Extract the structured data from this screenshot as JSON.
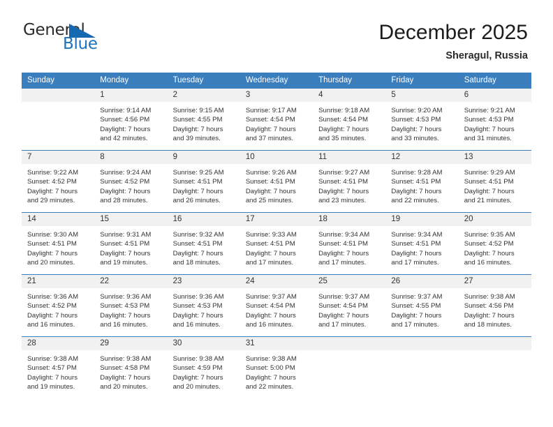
{
  "brand": {
    "name_part1": "General",
    "name_part2": "Blue",
    "triangle_icon": "triangle-icon",
    "colors": {
      "dark": "#2b2b2b",
      "blue": "#1e72bb",
      "header_blue": "#3b7ebe",
      "band_gray": "#f1f1f1"
    }
  },
  "header": {
    "title": "December 2025",
    "subtitle": "Sheragul, Russia"
  },
  "calendar": {
    "weekday_headers": [
      "Sunday",
      "Monday",
      "Tuesday",
      "Wednesday",
      "Thursday",
      "Friday",
      "Saturday"
    ],
    "weeks": [
      [
        {
          "day": "",
          "lines": []
        },
        {
          "day": "1",
          "lines": [
            "Sunrise: 9:14 AM",
            "Sunset: 4:56 PM",
            "Daylight: 7 hours",
            "and 42 minutes."
          ]
        },
        {
          "day": "2",
          "lines": [
            "Sunrise: 9:15 AM",
            "Sunset: 4:55 PM",
            "Daylight: 7 hours",
            "and 39 minutes."
          ]
        },
        {
          "day": "3",
          "lines": [
            "Sunrise: 9:17 AM",
            "Sunset: 4:54 PM",
            "Daylight: 7 hours",
            "and 37 minutes."
          ]
        },
        {
          "day": "4",
          "lines": [
            "Sunrise: 9:18 AM",
            "Sunset: 4:54 PM",
            "Daylight: 7 hours",
            "and 35 minutes."
          ]
        },
        {
          "day": "5",
          "lines": [
            "Sunrise: 9:20 AM",
            "Sunset: 4:53 PM",
            "Daylight: 7 hours",
            "and 33 minutes."
          ]
        },
        {
          "day": "6",
          "lines": [
            "Sunrise: 9:21 AM",
            "Sunset: 4:53 PM",
            "Daylight: 7 hours",
            "and 31 minutes."
          ]
        }
      ],
      [
        {
          "day": "7",
          "lines": [
            "Sunrise: 9:22 AM",
            "Sunset: 4:52 PM",
            "Daylight: 7 hours",
            "and 29 minutes."
          ]
        },
        {
          "day": "8",
          "lines": [
            "Sunrise: 9:24 AM",
            "Sunset: 4:52 PM",
            "Daylight: 7 hours",
            "and 28 minutes."
          ]
        },
        {
          "day": "9",
          "lines": [
            "Sunrise: 9:25 AM",
            "Sunset: 4:51 PM",
            "Daylight: 7 hours",
            "and 26 minutes."
          ]
        },
        {
          "day": "10",
          "lines": [
            "Sunrise: 9:26 AM",
            "Sunset: 4:51 PM",
            "Daylight: 7 hours",
            "and 25 minutes."
          ]
        },
        {
          "day": "11",
          "lines": [
            "Sunrise: 9:27 AM",
            "Sunset: 4:51 PM",
            "Daylight: 7 hours",
            "and 23 minutes."
          ]
        },
        {
          "day": "12",
          "lines": [
            "Sunrise: 9:28 AM",
            "Sunset: 4:51 PM",
            "Daylight: 7 hours",
            "and 22 minutes."
          ]
        },
        {
          "day": "13",
          "lines": [
            "Sunrise: 9:29 AM",
            "Sunset: 4:51 PM",
            "Daylight: 7 hours",
            "and 21 minutes."
          ]
        }
      ],
      [
        {
          "day": "14",
          "lines": [
            "Sunrise: 9:30 AM",
            "Sunset: 4:51 PM",
            "Daylight: 7 hours",
            "and 20 minutes."
          ]
        },
        {
          "day": "15",
          "lines": [
            "Sunrise: 9:31 AM",
            "Sunset: 4:51 PM",
            "Daylight: 7 hours",
            "and 19 minutes."
          ]
        },
        {
          "day": "16",
          "lines": [
            "Sunrise: 9:32 AM",
            "Sunset: 4:51 PM",
            "Daylight: 7 hours",
            "and 18 minutes."
          ]
        },
        {
          "day": "17",
          "lines": [
            "Sunrise: 9:33 AM",
            "Sunset: 4:51 PM",
            "Daylight: 7 hours",
            "and 17 minutes."
          ]
        },
        {
          "day": "18",
          "lines": [
            "Sunrise: 9:34 AM",
            "Sunset: 4:51 PM",
            "Daylight: 7 hours",
            "and 17 minutes."
          ]
        },
        {
          "day": "19",
          "lines": [
            "Sunrise: 9:34 AM",
            "Sunset: 4:51 PM",
            "Daylight: 7 hours",
            "and 17 minutes."
          ]
        },
        {
          "day": "20",
          "lines": [
            "Sunrise: 9:35 AM",
            "Sunset: 4:52 PM",
            "Daylight: 7 hours",
            "and 16 minutes."
          ]
        }
      ],
      [
        {
          "day": "21",
          "lines": [
            "Sunrise: 9:36 AM",
            "Sunset: 4:52 PM",
            "Daylight: 7 hours",
            "and 16 minutes."
          ]
        },
        {
          "day": "22",
          "lines": [
            "Sunrise: 9:36 AM",
            "Sunset: 4:53 PM",
            "Daylight: 7 hours",
            "and 16 minutes."
          ]
        },
        {
          "day": "23",
          "lines": [
            "Sunrise: 9:36 AM",
            "Sunset: 4:53 PM",
            "Daylight: 7 hours",
            "and 16 minutes."
          ]
        },
        {
          "day": "24",
          "lines": [
            "Sunrise: 9:37 AM",
            "Sunset: 4:54 PM",
            "Daylight: 7 hours",
            "and 16 minutes."
          ]
        },
        {
          "day": "25",
          "lines": [
            "Sunrise: 9:37 AM",
            "Sunset: 4:54 PM",
            "Daylight: 7 hours",
            "and 17 minutes."
          ]
        },
        {
          "day": "26",
          "lines": [
            "Sunrise: 9:37 AM",
            "Sunset: 4:55 PM",
            "Daylight: 7 hours",
            "and 17 minutes."
          ]
        },
        {
          "day": "27",
          "lines": [
            "Sunrise: 9:38 AM",
            "Sunset: 4:56 PM",
            "Daylight: 7 hours",
            "and 18 minutes."
          ]
        }
      ],
      [
        {
          "day": "28",
          "lines": [
            "Sunrise: 9:38 AM",
            "Sunset: 4:57 PM",
            "Daylight: 7 hours",
            "and 19 minutes."
          ]
        },
        {
          "day": "29",
          "lines": [
            "Sunrise: 9:38 AM",
            "Sunset: 4:58 PM",
            "Daylight: 7 hours",
            "and 20 minutes."
          ]
        },
        {
          "day": "30",
          "lines": [
            "Sunrise: 9:38 AM",
            "Sunset: 4:59 PM",
            "Daylight: 7 hours",
            "and 20 minutes."
          ]
        },
        {
          "day": "31",
          "lines": [
            "Sunrise: 9:38 AM",
            "Sunset: 5:00 PM",
            "Daylight: 7 hours",
            "and 22 minutes."
          ]
        },
        {
          "day": "",
          "lines": []
        },
        {
          "day": "",
          "lines": []
        },
        {
          "day": "",
          "lines": []
        }
      ]
    ]
  }
}
